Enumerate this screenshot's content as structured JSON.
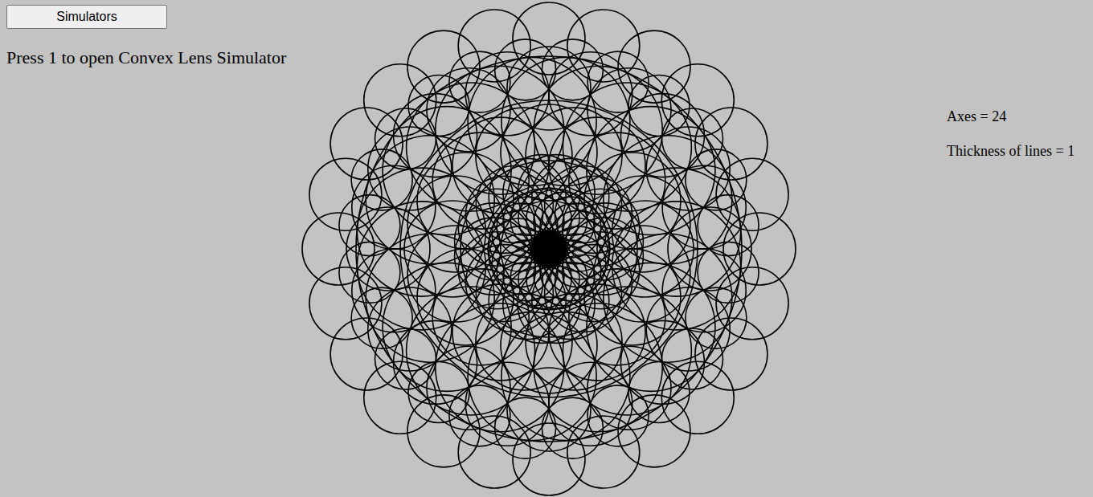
{
  "toolbar": {
    "button": "Simulators"
  },
  "hint": "Press 1 to open Convex Lens Simulator",
  "settings": [
    {
      "label": "Axes = 24"
    },
    {
      "label": "Thickness of lines = 1"
    }
  ]
}
